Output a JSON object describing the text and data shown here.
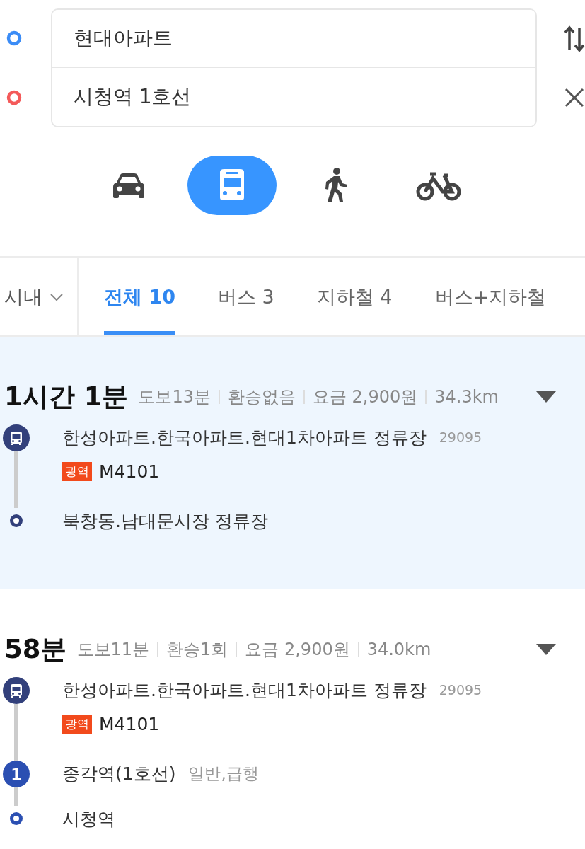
{
  "route_inputs": [
    {
      "kind": "origin",
      "value": "현대아파트"
    },
    {
      "kind": "destination",
      "value": "시청역 1호선"
    }
  ],
  "modes": [
    {
      "kind": "car",
      "selected": false
    },
    {
      "kind": "bus",
      "selected": true
    },
    {
      "kind": "walk",
      "selected": false
    },
    {
      "kind": "bike",
      "selected": false
    }
  ],
  "region_filter": "시내",
  "tabs": [
    {
      "label": "전체 10",
      "selected": true
    },
    {
      "label": "버스 3",
      "selected": false
    },
    {
      "label": "지하철 4",
      "selected": false
    },
    {
      "label": "버스+지하철",
      "selected": false
    }
  ],
  "routes": [
    {
      "selected": true,
      "duration": "1시간 1분",
      "meta": [
        "도보13분",
        "환승없음",
        "요금 2,900원",
        "34.3km"
      ],
      "steps": [
        {
          "kind": "bus",
          "name": "한성아파트.한국아파트.현대1차아파트 정류장",
          "stop_id": "29095",
          "badge": "광역",
          "line": "M4101"
        },
        {
          "kind": "end",
          "name": "북창동.남대문시장 정류장"
        }
      ]
    },
    {
      "selected": false,
      "duration": "58분",
      "meta": [
        "도보11분",
        "환승1회",
        "요금 2,900원",
        "34.0km"
      ],
      "steps": [
        {
          "kind": "bus",
          "name": "한성아파트.한국아파트.현대1차아파트 정류장",
          "stop_id": "29095",
          "badge": "광역",
          "line": "M4101"
        },
        {
          "kind": "subway",
          "marker": "1",
          "name": "종각역(1호선)",
          "note": "일반,급행"
        },
        {
          "kind": "end",
          "name": "시청역"
        }
      ]
    }
  ]
}
